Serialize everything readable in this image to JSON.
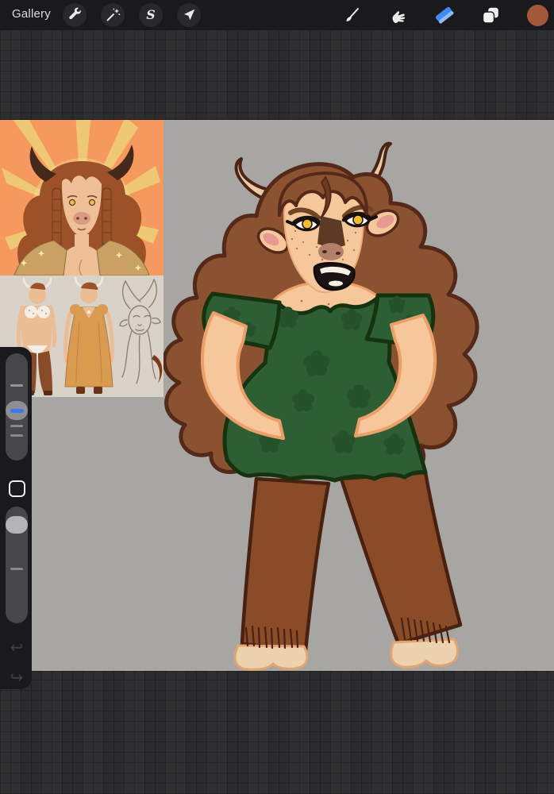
{
  "topbar": {
    "gallery_label": "Gallery",
    "left_icons": [
      "wrench-icon",
      "adjustments-icon",
      "selection-icon",
      "transform-icon"
    ],
    "right_icons": [
      "brush-icon",
      "smudge-icon",
      "eraser-icon",
      "layers-icon",
      "color-swatch"
    ],
    "active_tool": "eraser",
    "eraser_active_color": "#3f8bf5",
    "color_swatch_color": "#a5573a"
  },
  "sidebar": {
    "accent_color": "#3b79f2",
    "controls": [
      "brush-size-slider",
      "modify-button",
      "opacity-slider",
      "undo-button",
      "redo-button"
    ],
    "undo_glyph": "↩",
    "redo_glyph": "↪"
  },
  "canvas": {
    "background_color": "#a8a6a3",
    "workspace_color": "#2b2b2d",
    "artwork": {
      "main_subject": "minotaur woman, brown curly hair, cream horns, green flower dress, hands on hips, brown fur legs with hooves",
      "reference_portrait": "horned woman portrait on orange sunburst background",
      "reference_sheet": "character turnaround: bikini pose, gold dress pose, pencil head sketch",
      "palette": {
        "skin": "#f5c79b",
        "skin_outline": "#ed9f6a",
        "hair": "#8a5230",
        "hair_outline": "#55291a",
        "horn": "#e9cbaa",
        "horn_outline": "#4c2413",
        "dress": "#2e5e33",
        "dress_flower": "#26522b",
        "dress_outline": "#16330f",
        "fur_leg": "#8a4c28",
        "fur_outline": "#4a2010",
        "hoof": "#ecd2ae",
        "eye_iris": "#f4bb2e",
        "portrait_bg": "#f6995e",
        "portrait_rays": "#ecd87c",
        "sheet_bg": "#d9d2c9",
        "gold_dress": "#d89b50"
      }
    }
  }
}
